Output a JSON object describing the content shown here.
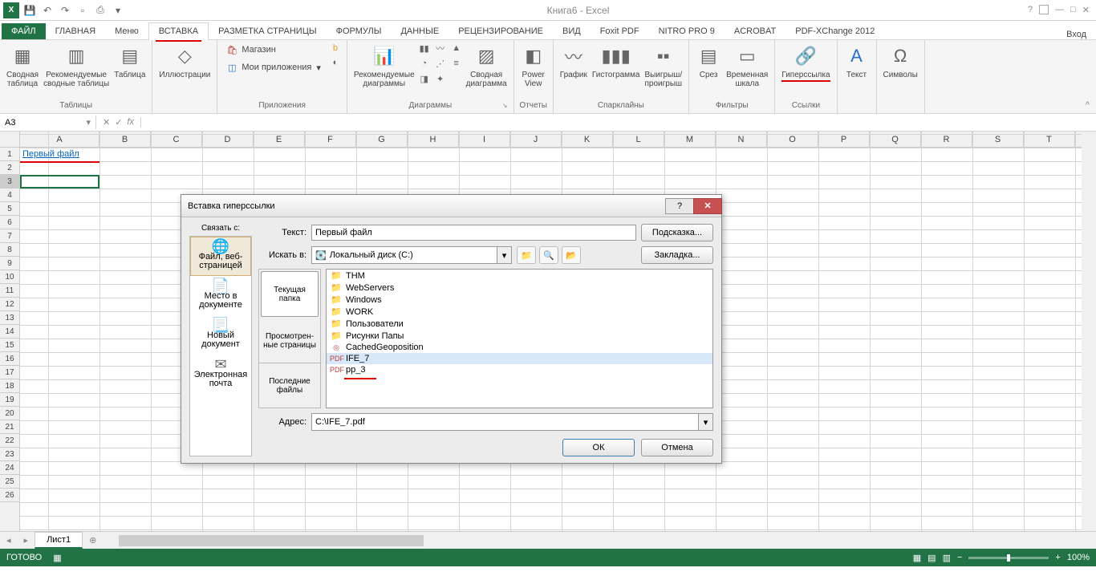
{
  "app": {
    "title": "Книга6 - Excel"
  },
  "tabs": {
    "file": "ФАЙЛ",
    "home": "ГЛАВНАЯ",
    "menu": "Меню",
    "insert": "ВСТАВКА",
    "layout": "РАЗМЕТКА СТРАНИЦЫ",
    "formulas": "ФОРМУЛЫ",
    "data": "ДАННЫЕ",
    "review": "РЕЦЕНЗИРОВАНИЕ",
    "view": "ВИД",
    "foxit": "Foxit PDF",
    "nitro": "NITRO PRO 9",
    "acrobat": "ACROBAT",
    "pdfx": "PDF-XChange 2012",
    "login": "Вход"
  },
  "ribbon": {
    "tables": {
      "label": "Таблицы",
      "pivot": "Сводная\nтаблица",
      "recommended": "Рекомендуемые\nсводные таблицы",
      "table": "Таблица"
    },
    "illustrations": {
      "label": "Иллюстрации"
    },
    "apps": {
      "label": "Приложения",
      "store": "Магазин",
      "myapps": "Мои приложения"
    },
    "charts": {
      "label": "Диаграммы",
      "rec": "Рекомендуемые\nдиаграммы",
      "pivot": "Сводная\nдиаграмма"
    },
    "reports": {
      "label": "Отчеты",
      "power": "Power\nView"
    },
    "spark": {
      "label": "Спарклайны",
      "line": "График",
      "hist": "Гистограмма",
      "winloss": "Выигрыш/\nпроигрыш"
    },
    "filters": {
      "label": "Фильтры",
      "slicer": "Срез",
      "timeline": "Временная\nшкала"
    },
    "links": {
      "label": "Ссылки",
      "hyper": "Гиперссылка"
    },
    "text": {
      "label": "Текст",
      "text": "Текст"
    },
    "symbols": {
      "label": "Символы",
      "sym": "Символы"
    }
  },
  "namebox": "A3",
  "cell": {
    "a1": "Первый файл"
  },
  "cols": [
    "A",
    "B",
    "C",
    "D",
    "E",
    "F",
    "G",
    "H",
    "I",
    "J",
    "K",
    "L",
    "M",
    "N",
    "O",
    "P",
    "Q",
    "R",
    "S",
    "T"
  ],
  "rows": [
    "1",
    "2",
    "3",
    "4",
    "5",
    "6",
    "7",
    "8",
    "9",
    "10",
    "11",
    "12",
    "13",
    "14",
    "15",
    "16",
    "17",
    "18",
    "19",
    "20",
    "21",
    "22",
    "23",
    "24",
    "25",
    "26"
  ],
  "sheet": {
    "name": "Лист1"
  },
  "status": {
    "ready": "ГОТОВО",
    "zoom": "100%"
  },
  "dialog": {
    "title": "Вставка гиперссылки",
    "linkto": "Связать с:",
    "opts": {
      "file": "Файл, веб-\nстраницей",
      "place": "Место в\nдокументе",
      "new": "Новый\nдокумент",
      "email": "Электронная\nпочта"
    },
    "text_label": "Текст:",
    "text_val": "Первый файл",
    "hint": "Подсказка...",
    "lookin": "Искать в:",
    "lookin_val": "Локальный диск (C:)",
    "bookmark": "Закладка...",
    "tabs": {
      "current": "Текущая\nпапка",
      "browsed": "Просмотрен-\nные\nстраницы",
      "recent": "Последние\nфайлы"
    },
    "files": [
      "THM",
      "WebServers",
      "Windows",
      "WORK",
      "Пользователи",
      "Рисунки Папы",
      "CachedGeoposition",
      "IFE_7",
      "pp_3"
    ],
    "addr_label": "Адрес:",
    "addr_val": "C:\\IFE_7.pdf",
    "ok": "ОК",
    "cancel": "Отмена"
  }
}
